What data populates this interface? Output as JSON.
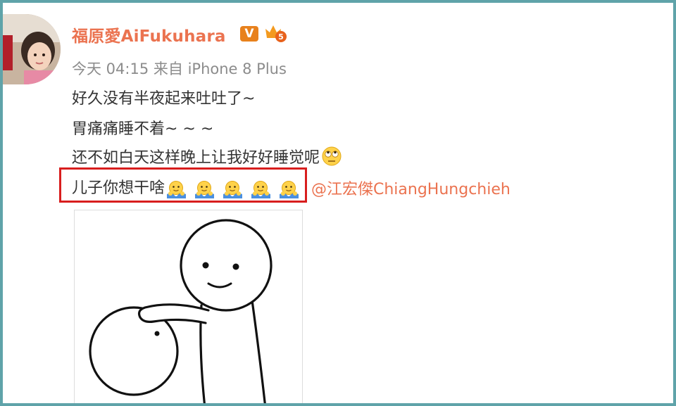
{
  "post": {
    "username": "福原愛AiFukuhara",
    "verified_badge": "V",
    "time": "今天 04:15",
    "source": "来自 iPhone 8 Plus",
    "lines": [
      "好久没有半夜起来吐吐了~",
      "胃痛痛睡不着~ ~ ~",
      "还不如白天这样晚上让我好好睡觉呢",
      "儿子你想干啥"
    ],
    "mention": "@江宏傑ChiangHungchieh",
    "emoji_after_line3": "rolling-eyes-emoji",
    "emoji_after_line4": "hug-emoji",
    "emoji_after_line4_count": 5
  },
  "colors": {
    "username": "#eb7350",
    "mention": "#eb7350",
    "highlight_box": "#d81e1e",
    "frame": "#5fa3a9"
  }
}
